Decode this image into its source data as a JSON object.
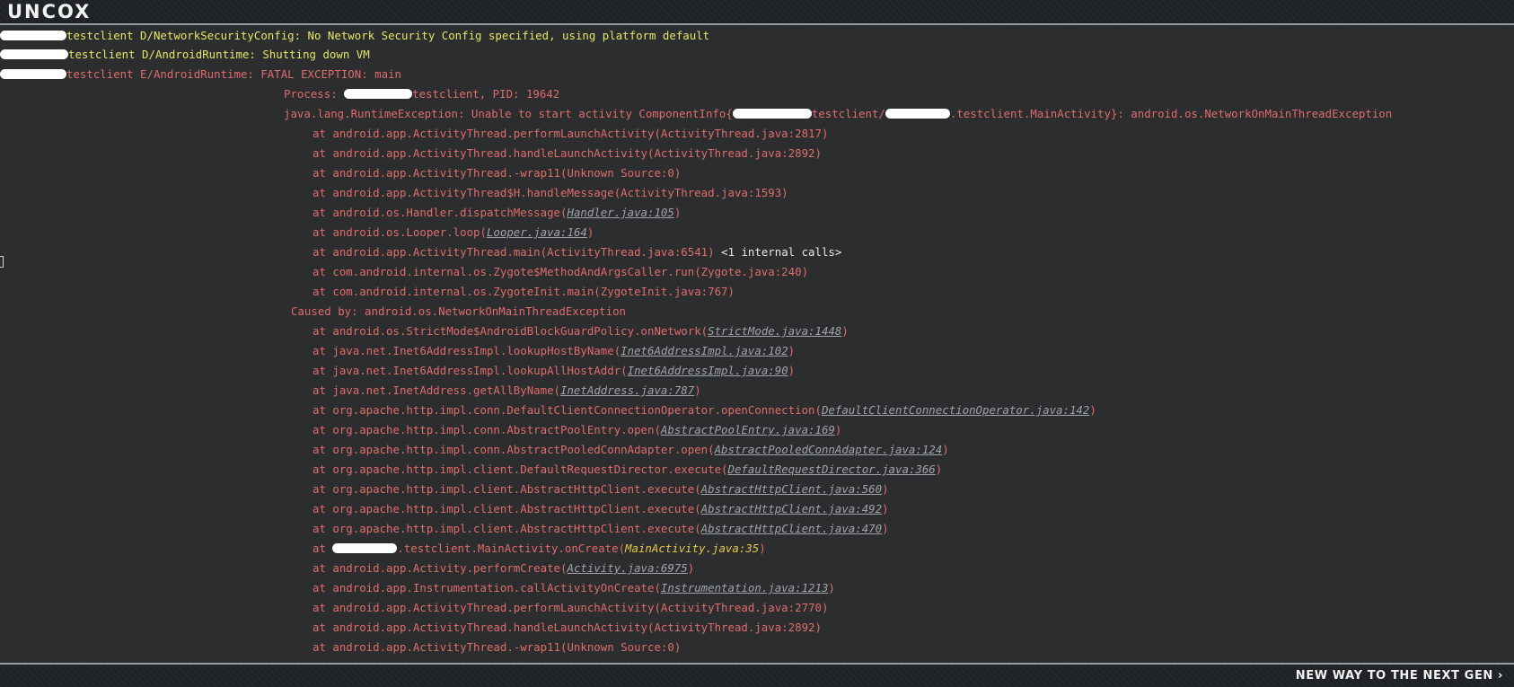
{
  "header": {
    "logo": "UNCOX"
  },
  "footer": {
    "tagline": "NEW WAY TO THE NEXT GEN ›"
  },
  "log": {
    "l1": "testclient D/NetworkSecurityConfig: No Network Security Config specified, using platform default",
    "l2": "testclient D/AndroidRuntime: Shutting down VM",
    "l3": "testclient E/AndroidRuntime: FATAL EXCEPTION: main",
    "l4a": "Process: ",
    "l4b": "testclient, PID: 19642",
    "l5a": "java.lang.RuntimeException: Unable to start activity ComponentInfo{",
    "l5b": "testclient/",
    "l5c": ".testclient.MainActivity}: android.os.NetworkOnMainThreadException",
    "l6": "at android.app.ActivityThread.performLaunchActivity(ActivityThread.java:2817)",
    "l7": "at android.app.ActivityThread.handleLaunchActivity(ActivityThread.java:2892)",
    "l8": "at android.app.ActivityThread.-wrap11(Unknown Source:0)",
    "l9": "at android.app.ActivityThread$H.handleMessage(ActivityThread.java:1593)",
    "l10a": "at android.os.Handler.dispatchMessage(",
    "l10b": "Handler.java:105",
    "l11a": "at android.os.Looper.loop(",
    "l11b": "Looper.java:164",
    "l12a": "at android.app.ActivityThread.main(ActivityThread.java:6541) ",
    "l12b": "<1 internal calls>",
    "l13": "at com.android.internal.os.Zygote$MethodAndArgsCaller.run(Zygote.java:240)",
    "l14": "at com.android.internal.os.ZygoteInit.main(ZygoteInit.java:767)",
    "l15": "Caused by: android.os.NetworkOnMainThreadException",
    "l16a": "at android.os.StrictMode$AndroidBlockGuardPolicy.onNetwork(",
    "l16b": "StrictMode.java:1448",
    "l17a": "at java.net.Inet6AddressImpl.lookupHostByName(",
    "l17b": "Inet6AddressImpl.java:102",
    "l18a": "at java.net.Inet6AddressImpl.lookupAllHostAddr(",
    "l18b": "Inet6AddressImpl.java:90",
    "l19a": "at java.net.InetAddress.getAllByName(",
    "l19b": "InetAddress.java:787",
    "l20a": "at org.apache.http.impl.conn.DefaultClientConnectionOperator.openConnection(",
    "l20b": "DefaultClientConnectionOperator.java:142",
    "l21a": "at org.apache.http.impl.conn.AbstractPoolEntry.open(",
    "l21b": "AbstractPoolEntry.java:169",
    "l22a": "at org.apache.http.impl.conn.AbstractPooledConnAdapter.open(",
    "l22b": "AbstractPooledConnAdapter.java:124",
    "l23a": "at org.apache.http.impl.client.DefaultRequestDirector.execute(",
    "l23b": "DefaultRequestDirector.java:366",
    "l24a": "at org.apache.http.impl.client.AbstractHttpClient.execute(",
    "l24b": "AbstractHttpClient.java:560",
    "l25a": "at org.apache.http.impl.client.AbstractHttpClient.execute(",
    "l25b": "AbstractHttpClient.java:492",
    "l26a": "at org.apache.http.impl.client.AbstractHttpClient.execute(",
    "l26b": "AbstractHttpClient.java:470",
    "l27a": "at ",
    "l27b": ".testclient.MainActivity.onCreate(",
    "l27c": "MainActivity.java:35",
    "l28a": "at android.app.Activity.performCreate(",
    "l28b": "Activity.java:6975",
    "l29a": "at android.app.Instrumentation.callActivityOnCreate(",
    "l29b": "Instrumentation.java:1213",
    "l30": "at android.app.ActivityThread.performLaunchActivity(ActivityThread.java:2770)",
    "l31": "at android.app.ActivityThread.handleLaunchActivity(ActivityThread.java:2892)",
    "l32": "at android.app.ActivityThread.-wrap11(Unknown Source:0)",
    "close": ")"
  },
  "colors": {
    "background": "#2b2d2e",
    "error_text": "#e06c6c",
    "debug_text": "#e6e66a",
    "link_text": "#9fa4a7",
    "highlight_link": "#e6c84a"
  }
}
